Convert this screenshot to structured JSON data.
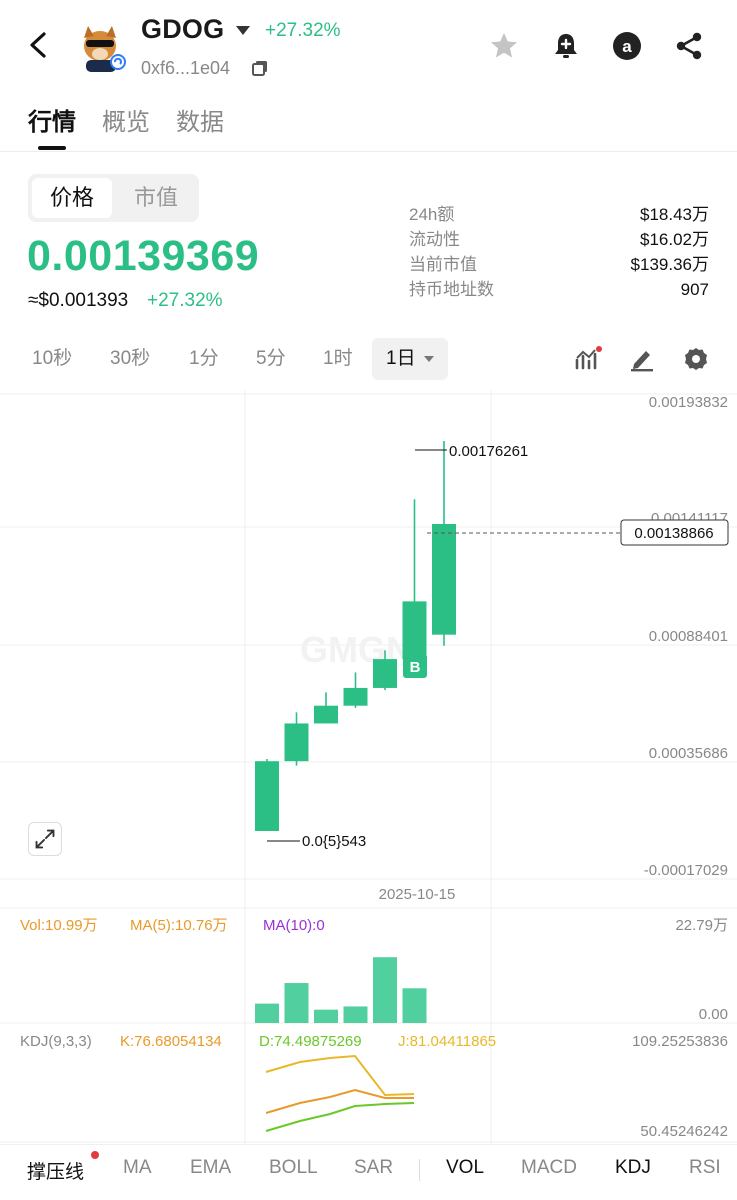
{
  "header": {
    "token_name": "GDOG",
    "change": "+27.32%",
    "address": "0xf6...1e04"
  },
  "tabs": [
    {
      "label": "行情",
      "active": true
    },
    {
      "label": "概览",
      "active": false
    },
    {
      "label": "数据",
      "active": false
    }
  ],
  "toggle": {
    "price_label": "价格",
    "mcap_label": "市值"
  },
  "price": {
    "value": "0.00139369",
    "usd": "≈$0.001393",
    "change": "+27.32%"
  },
  "stats": [
    {
      "label": "24h额",
      "value": "$18.43万"
    },
    {
      "label": "流动性",
      "value": "$16.02万"
    },
    {
      "label": "当前市值",
      "value": "$139.36万"
    },
    {
      "label": "持币地址数",
      "value": "907"
    }
  ],
  "timeframes": [
    {
      "label": "10秒"
    },
    {
      "label": "30秒"
    },
    {
      "label": "1分"
    },
    {
      "label": "5分"
    },
    {
      "label": "1时"
    },
    {
      "label": "1日",
      "selected": true
    }
  ],
  "chart_data": {
    "type": "candlestick",
    "price_axis_ticks": [
      "0.00193832",
      "0.00141117",
      "0.00088401",
      "0.00035686",
      "-0.00017029"
    ],
    "current_price_label": "0.00138866",
    "high_annotation": "0.00176261",
    "low_annotation": "0.0{5}543",
    "x_label": "2025-10-15",
    "buy_marker": "B",
    "candles": [
      {
        "open": 5.43e-06,
        "close": 0.00032,
        "high": 0.00033,
        "low": 5.43e-06
      },
      {
        "open": 0.00032,
        "close": 0.00049,
        "high": 0.00054,
        "low": 0.0003
      },
      {
        "open": 0.00049,
        "close": 0.00057,
        "high": 0.00063,
        "low": 0.00049
      },
      {
        "open": 0.00057,
        "close": 0.00065,
        "high": 0.00072,
        "low": 0.00056
      },
      {
        "open": 0.00065,
        "close": 0.00078,
        "high": 0.00082,
        "low": 0.00064
      },
      {
        "open": 0.00078,
        "close": 0.00104,
        "high": 0.0015,
        "low": 0.00075
      },
      {
        "open": 0.00089,
        "close": 0.00138866,
        "high": 0.00176261,
        "low": 0.00084
      }
    ]
  },
  "volume": {
    "vol_label": "Vol:10.99万",
    "ma5_label": "MA(5):10.76万",
    "ma10_label": "MA(10):0",
    "axis_top": "22.79万",
    "axis_bottom": "0.00",
    "bars": [
      4.8,
      9.9,
      3.3,
      4.1,
      16.3,
      8.6
    ],
    "colors": {
      "vol": "#e89a2a",
      "ma5": "#e89a2a",
      "ma10": "#9b30d9"
    }
  },
  "kdj": {
    "title": "KDJ(9,3,3)",
    "k_label": "K:76.68054134",
    "d_label": "D:74.49875269",
    "j_label": "J:81.04411865",
    "axis_top": "109.25253836",
    "axis_bottom": "50.45246242",
    "colors": {
      "k": "#e89a2a",
      "d": "#6ac82a",
      "j": "#e8b82a"
    }
  },
  "bottom_bar": {
    "left_items": [
      "撑压线",
      "MA",
      "EMA",
      "BOLL",
      "SAR"
    ],
    "right_items": [
      "VOL",
      "MACD",
      "KDJ",
      "RSI"
    ]
  },
  "colors": {
    "up": "#2bbf86",
    "accent": "#2bbf86"
  }
}
